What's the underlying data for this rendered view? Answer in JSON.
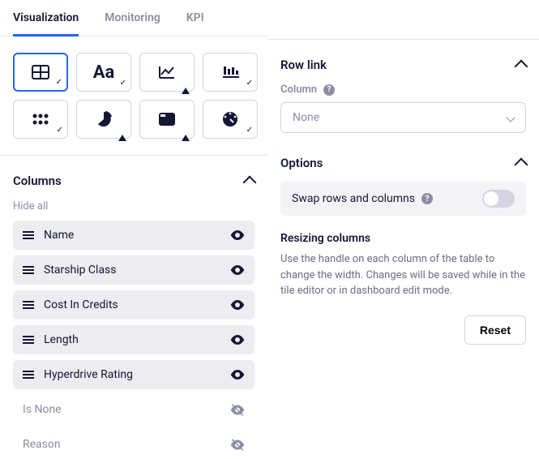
{
  "tabs": {
    "visualization": "Visualization",
    "monitoring": "Monitoring",
    "kpi": "KPI"
  },
  "columns_section": {
    "title": "Columns",
    "hide_all": "Hide all",
    "items": [
      {
        "label": "Name"
      },
      {
        "label": "Starship Class"
      },
      {
        "label": "Cost In Credits"
      },
      {
        "label": "Length"
      },
      {
        "label": "Hyperdrive Rating"
      }
    ],
    "hidden_items": [
      {
        "label": "Is None"
      },
      {
        "label": "Reason"
      }
    ]
  },
  "row_link": {
    "title": "Row link",
    "column_label": "Column",
    "selected": "None"
  },
  "options": {
    "title": "Options",
    "swap_label": "Swap rows and columns",
    "resize_title": "Resizing columns",
    "resize_desc": "Use the handle on each column of the table to change the width. Changes will be saved while in the tile editor or in dashboard edit mode.",
    "reset_label": "Reset"
  }
}
